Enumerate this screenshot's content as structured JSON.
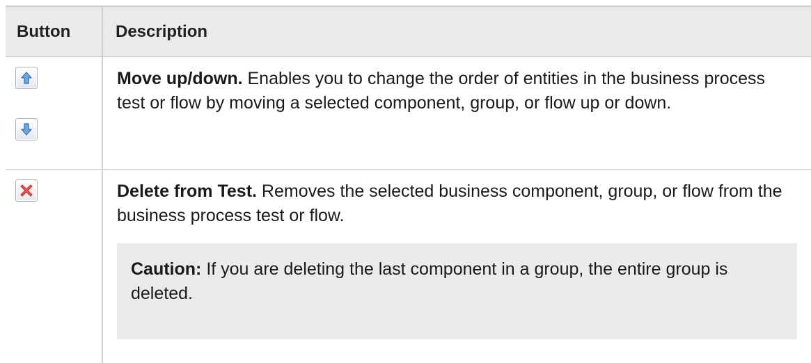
{
  "table": {
    "header": {
      "button": "Button",
      "description": "Description"
    },
    "rows": [
      {
        "buttons": [
          "arrow-up-icon",
          "arrow-down-icon"
        ],
        "title": "Move up/down.",
        "text": " Enables you to change the order of entities in the business process test or flow by moving a selected component, group, or flow up or down."
      },
      {
        "buttons": [
          "delete-x-icon"
        ],
        "title": "Delete from Test.",
        "text": " Removes the selected business component, group, or flow from the business process test or flow.",
        "note": {
          "title": "Caution:",
          "text": " If you are deleting the last component in a group, the entire group is deleted."
        }
      }
    ]
  },
  "colors": {
    "header_bg": "#ebebeb",
    "arrow_blue": "#3a79c8",
    "delete_red": "#e03a2a"
  }
}
